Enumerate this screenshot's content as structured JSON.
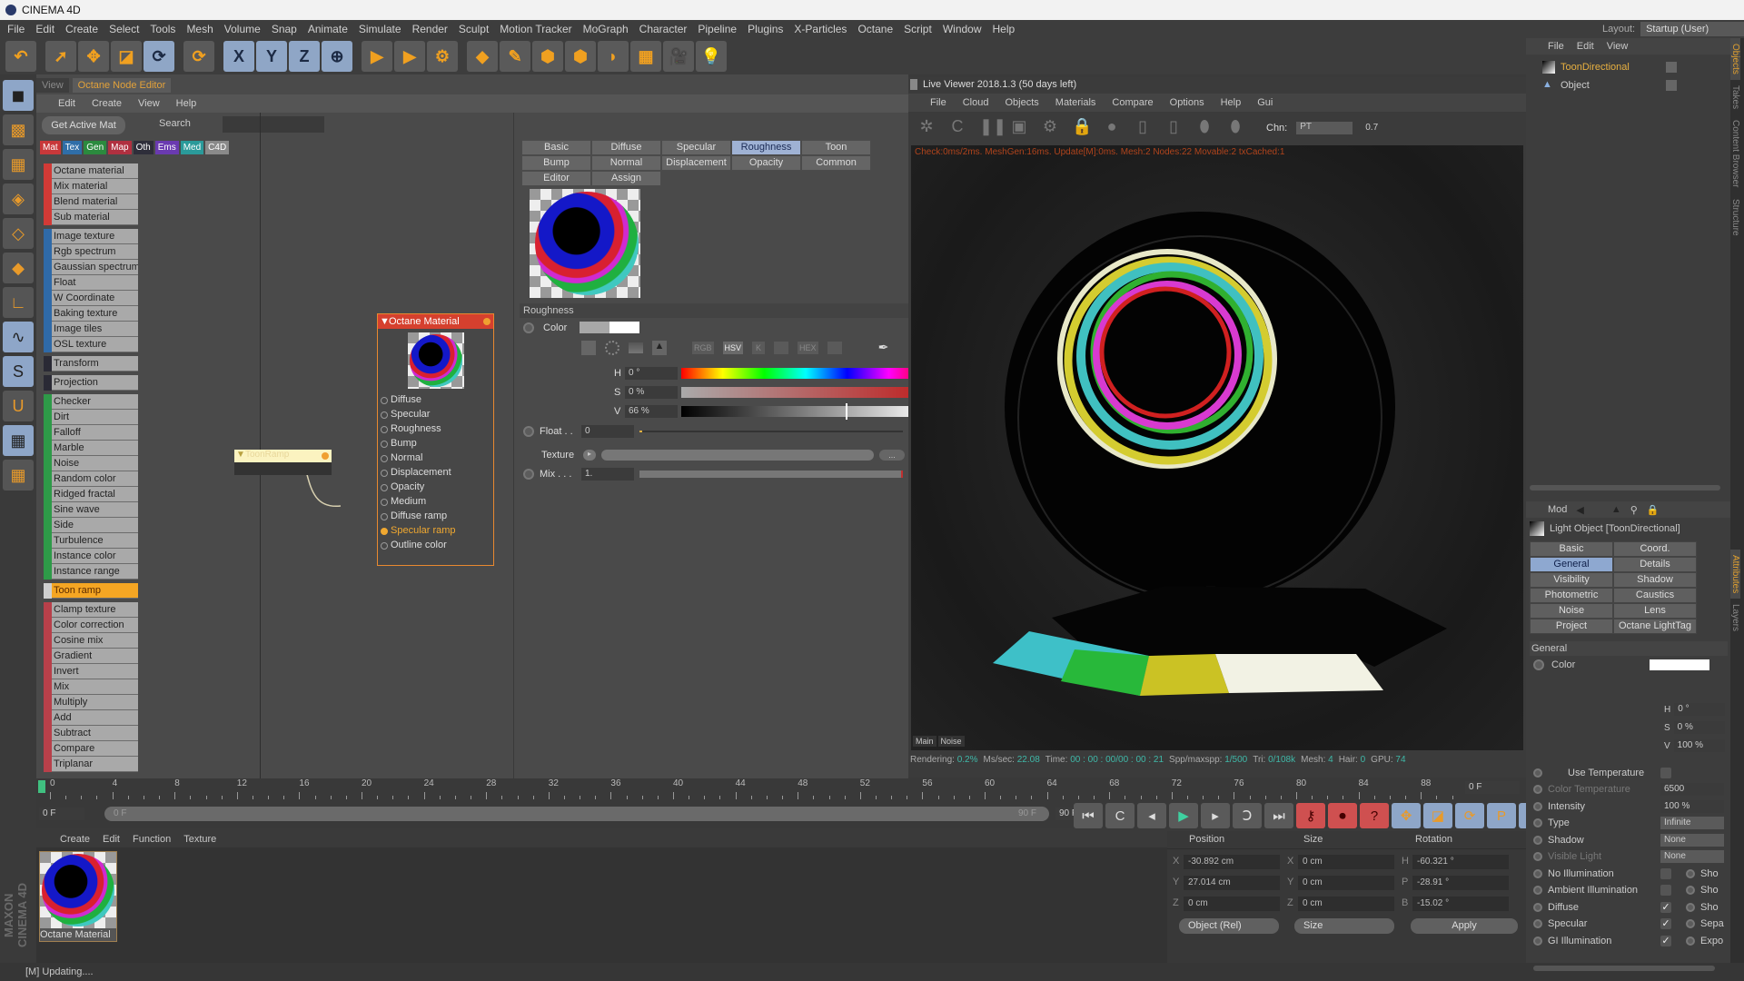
{
  "app": {
    "title": "CINEMA 4D"
  },
  "menubar": [
    "File",
    "Edit",
    "Create",
    "Select",
    "Tools",
    "Mesh",
    "Volume",
    "Snap",
    "Animate",
    "Simulate",
    "Render",
    "Sculpt",
    "Motion Tracker",
    "MoGraph",
    "Character",
    "Pipeline",
    "Plugins",
    "X-Particles",
    "Octane",
    "Script",
    "Window",
    "Help"
  ],
  "layout": {
    "label": "Layout:",
    "value": "Startup (User)"
  },
  "toolbar": [
    {
      "icon": "undo-icon",
      "glyph": "↶"
    },
    {
      "icon": "select-icon",
      "glyph": "➚",
      "gap": true
    },
    {
      "icon": "move-icon",
      "glyph": "✥"
    },
    {
      "icon": "scale-icon",
      "glyph": "◪"
    },
    {
      "icon": "rotate-icon",
      "glyph": "⟳",
      "blue": true
    },
    {
      "icon": "recent-tool-icon",
      "glyph": "⟳",
      "gap": true
    },
    {
      "icon": "x-axis-icon",
      "glyph": "X",
      "blue": true,
      "gap": true
    },
    {
      "icon": "y-axis-icon",
      "glyph": "Y",
      "blue": true
    },
    {
      "icon": "z-axis-icon",
      "glyph": "Z",
      "blue": true
    },
    {
      "icon": "coordinate-system-icon",
      "glyph": "⊕",
      "blue": true
    },
    {
      "icon": "render-view-icon",
      "glyph": "▶",
      "gap": true
    },
    {
      "icon": "render-picture-viewer-icon",
      "glyph": "▶"
    },
    {
      "icon": "render-settings-icon",
      "glyph": "⚙"
    },
    {
      "icon": "cube-icon",
      "glyph": "◆",
      "gap": true
    },
    {
      "icon": "pen-icon",
      "glyph": "✎"
    },
    {
      "icon": "subdivision-icon",
      "glyph": "⬢"
    },
    {
      "icon": "cloner-icon",
      "glyph": "⬢"
    },
    {
      "icon": "deformer-icon",
      "glyph": "◗"
    },
    {
      "icon": "floor-icon",
      "glyph": "▦"
    },
    {
      "icon": "camera-icon",
      "glyph": "🎥"
    },
    {
      "icon": "light-icon",
      "glyph": "💡"
    }
  ],
  "left_icons": [
    {
      "icon": "model-mode-icon",
      "glyph": "◼",
      "blue": true
    },
    {
      "icon": "texture-mode-icon",
      "glyph": "▩"
    },
    {
      "icon": "workplane-icon",
      "glyph": "▦"
    },
    {
      "icon": "points-mode-icon",
      "glyph": "◈"
    },
    {
      "icon": "edges-mode-icon",
      "glyph": "◇"
    },
    {
      "icon": "polygons-mode-icon",
      "glyph": "◆"
    },
    {
      "icon": "axis-icon",
      "glyph": "∟"
    },
    {
      "icon": "tweak-icon",
      "glyph": "∿",
      "blue": true
    },
    {
      "icon": "snap-icon",
      "glyph": "S",
      "blue": true
    },
    {
      "icon": "magnet-icon",
      "glyph": "U"
    },
    {
      "icon": "lock-workplane-icon",
      "glyph": "▦",
      "blue": true
    },
    {
      "icon": "planar-workplane-icon",
      "glyph": "▦"
    }
  ],
  "branding": "MAXON CINEMA 4D",
  "node_editor": {
    "tabs": [
      "View",
      "Octane Node Editor"
    ],
    "menu": [
      "Edit",
      "Create",
      "View",
      "Help"
    ],
    "get_active_mat": "Get Active Mat",
    "search_label": "Search",
    "categories": [
      {
        "label": "Mat",
        "color": "#c8383a"
      },
      {
        "label": "Tex",
        "color": "#2f6ea8"
      },
      {
        "label": "Gen",
        "color": "#2b8a3e"
      },
      {
        "label": "Map",
        "color": "#b03040"
      },
      {
        "label": "Oth",
        "color": "#2e2e3a"
      },
      {
        "label": "Ems",
        "color": "#6a3ab0"
      },
      {
        "label": "Med",
        "color": "#2a9a9a"
      },
      {
        "label": "C4D",
        "color": "#8a8a8a"
      }
    ],
    "groups": [
      {
        "color": "#d23a36",
        "items": [
          "Octane material",
          "Mix material",
          "Blend material",
          "Sub material"
        ]
      },
      {
        "color": "#2f6aa8",
        "items": [
          "Image texture",
          "Rgb spectrum",
          "Gaussian spectrum",
          "Float",
          "W Coordinate",
          "Baking texture",
          "Image tiles",
          "OSL texture"
        ]
      },
      {
        "color": "#2a2a35",
        "items": [
          "Transform"
        ]
      },
      {
        "color": "#2a2a35",
        "items": [
          "Projection"
        ]
      },
      {
        "color": "#2e9a48",
        "items": [
          "Checker",
          "Dirt",
          "Falloff",
          "Marble",
          "Noise",
          "Random color",
          "Ridged fractal",
          "Sine wave",
          "Side",
          "Turbulence",
          "Instance color",
          "Instance range"
        ]
      },
      {
        "color": "#cfcfcf",
        "items": [
          "Toon ramp"
        ],
        "selected": 0
      },
      {
        "color": "#b8404a",
        "items": [
          "Clamp texture",
          "Color correction",
          "Cosine mix",
          "Gradient",
          "Invert",
          "Mix",
          "Multiply",
          "Add",
          "Subtract",
          "Compare",
          "Triplanar"
        ]
      }
    ],
    "toon_node": {
      "title": "ToonRamp"
    },
    "octane_node": {
      "title": "Octane Material",
      "ports": [
        "Diffuse",
        "Specular",
        "Roughness",
        "Bump",
        "Normal",
        "Displacement",
        "Opacity",
        "Medium",
        "Diffuse ramp",
        "Specular ramp",
        "Outline color"
      ],
      "connected": "Specular ramp"
    }
  },
  "material": {
    "tabs": [
      "Basic",
      "Diffuse",
      "Specular",
      "Roughness",
      "Toon",
      "Bump",
      "Normal",
      "Displacement",
      "Opacity",
      "Common",
      "Editor",
      "Assign"
    ],
    "active_tab": "Roughness",
    "section": "Roughness",
    "color_label": "Color",
    "color_modes": [
      "RGB",
      "HSV",
      "K",
      "HEX"
    ],
    "active_mode": "HSV",
    "h": {
      "label": "H",
      "value": "0 °"
    },
    "s": {
      "label": "S",
      "value": "0 %"
    },
    "v": {
      "label": "V",
      "value": "66 %",
      "level": 0.66
    },
    "float": {
      "label": "Float . .",
      "value": "0"
    },
    "texture_label": "Texture",
    "texture_btn": "...",
    "mix": {
      "label": "Mix . . .",
      "value": "1."
    }
  },
  "viewer": {
    "title": "Live Viewer 2018.1.3 (50 days left)",
    "menu": [
      "File",
      "Cloud",
      "Objects",
      "Materials",
      "Compare",
      "Options",
      "Help",
      "Gui"
    ],
    "tools": [
      "start-render-icon",
      "restart-icon",
      "pause-icon",
      "region-icon",
      "settings-icon",
      "lock-icon",
      "clay-icon",
      "compare-a-icon",
      "compare-b-icon",
      "pin-icon",
      "marker-icon"
    ],
    "chn_label": "Chn:",
    "chn_value": "PT",
    "chn_param": "0.7",
    "overlay": "Check:0ms/2ms. MeshGen:16ms. Update[M]:0ms. Mesh:2 Nodes:22 Movable:2 txCached:1",
    "buttons": [
      "Main",
      "Noise"
    ],
    "status": [
      {
        "k": "Rendering:",
        "v": "0.2%"
      },
      {
        "k": "Ms/sec:",
        "v": "22.08"
      },
      {
        "k": "Time:",
        "v": "00 : 00 : 00/00 : 00 : 21"
      },
      {
        "k": "Spp/maxspp:",
        "v": "1/500"
      },
      {
        "k": "Tri:",
        "v": "0/108k"
      },
      {
        "k": "Mesh:",
        "v": "4"
      },
      {
        "k": "Hair:",
        "v": "0"
      },
      {
        "k": "GPU:",
        "v": "74"
      }
    ]
  },
  "timeline": {
    "ticks": [
      "0",
      "4",
      "8",
      "12",
      "16",
      "20",
      "24",
      "28",
      "32",
      "36",
      "40",
      "44",
      "48",
      "52",
      "56",
      "60",
      "64",
      "68",
      "72",
      "76",
      "80",
      "84",
      "88"
    ],
    "current_frame": "0 F",
    "range_start": "0 F",
    "range_end": "90 F",
    "max_frame": "90 F",
    "frame_display": "0 F",
    "transport": [
      {
        "icon": "go-to-start-icon",
        "g": "⏮"
      },
      {
        "icon": "prev-key-icon",
        "g": "C"
      },
      {
        "icon": "prev-frame-icon",
        "g": "◂"
      },
      {
        "icon": "play-icon",
        "g": "▶",
        "color": "#3fd0a0"
      },
      {
        "icon": "next-frame-icon",
        "g": "▸"
      },
      {
        "icon": "next-key-icon",
        "g": "Ↄ"
      },
      {
        "icon": "go-to-end-icon",
        "g": "⏭"
      },
      {
        "icon": "record-icon",
        "g": "⚷",
        "red": true
      },
      {
        "icon": "autokey-icon",
        "g": "⏺",
        "red": true
      },
      {
        "icon": "keyframe-selection-icon",
        "g": "?",
        "red": true
      },
      {
        "icon": "key-position-icon",
        "g": "✥",
        "blue": true
      },
      {
        "icon": "key-scale-icon",
        "g": "◪",
        "blue": true
      },
      {
        "icon": "key-rotation-icon",
        "g": "⟳",
        "blue": true
      },
      {
        "icon": "key-param-icon",
        "g": "P",
        "blue": true
      },
      {
        "icon": "key-pla-icon",
        "g": "⠿",
        "blue": true
      },
      {
        "icon": "timeline-window-icon",
        "g": "▥",
        "blue": true
      }
    ]
  },
  "material_manager": {
    "menu": [
      "Create",
      "Edit",
      "Function",
      "Texture"
    ],
    "materials": [
      "Octane Material"
    ]
  },
  "coordinates": {
    "headers": [
      "Position",
      "Size",
      "Rotation"
    ],
    "position": [
      {
        "axis": "X",
        "value": "-30.892 cm"
      },
      {
        "axis": "Y",
        "value": "27.014 cm"
      },
      {
        "axis": "Z",
        "value": "0 cm"
      }
    ],
    "size": [
      {
        "axis": "X",
        "value": "0 cm"
      },
      {
        "axis": "Y",
        "value": "0 cm"
      },
      {
        "axis": "Z",
        "value": "0 cm"
      }
    ],
    "rotation": [
      {
        "axis": "H",
        "value": "-60.321 °"
      },
      {
        "axis": "P",
        "value": "-28.91 °"
      },
      {
        "axis": "B",
        "value": "-15.02 °"
      }
    ],
    "mode": "Object (Rel)",
    "size_mode": "Size",
    "apply": "Apply"
  },
  "status_bar": "[M]  Updating....",
  "objects": {
    "menu": [
      "File",
      "Edit",
      "View"
    ],
    "items": [
      {
        "name": "ToonDirectional",
        "selected": true
      },
      {
        "name": "Object"
      }
    ]
  },
  "attributes": {
    "menu": "Mod",
    "title": "Light Object [ToonDirectional]",
    "tabs": [
      "Basic",
      "Coord.",
      "General",
      "Details",
      "Visibility",
      "Shadow",
      "Photometric",
      "Caustics",
      "Noise",
      "Lens",
      "Project",
      "Octane LightTag"
    ],
    "active_tab": "General",
    "section": "General",
    "color_label": "Color",
    "h": "0 °",
    "s": "0 %",
    "v": "100 %",
    "rows": [
      {
        "label": "Use Temperature",
        "type": "check",
        "checked": false
      },
      {
        "label": "Color Temperature",
        "value": "6500",
        "dim": true
      },
      {
        "label": "Intensity",
        "value": "100 %"
      },
      {
        "label": "Type",
        "value": "Infinite"
      },
      {
        "label": "Shadow",
        "value": "None"
      },
      {
        "label": "Visible Light",
        "value": "None",
        "dim": true
      },
      {
        "label": "No Illumination",
        "type": "check",
        "checked": false,
        "right": "Sho"
      },
      {
        "label": "Ambient Illumination",
        "type": "check",
        "checked": false,
        "right": "Sho"
      },
      {
        "label": "Diffuse",
        "type": "check",
        "checked": true,
        "right": "Sho"
      },
      {
        "label": "Specular",
        "type": "check",
        "checked": true,
        "right": "Sepa"
      },
      {
        "label": "GI Illumination",
        "type": "check",
        "checked": true,
        "right": "Expo"
      }
    ]
  },
  "side_tabs": {
    "top": [
      "Objects",
      "Takes",
      "Content Browser",
      "Structure"
    ],
    "bottom": [
      "Attributes",
      "Layers"
    ]
  }
}
